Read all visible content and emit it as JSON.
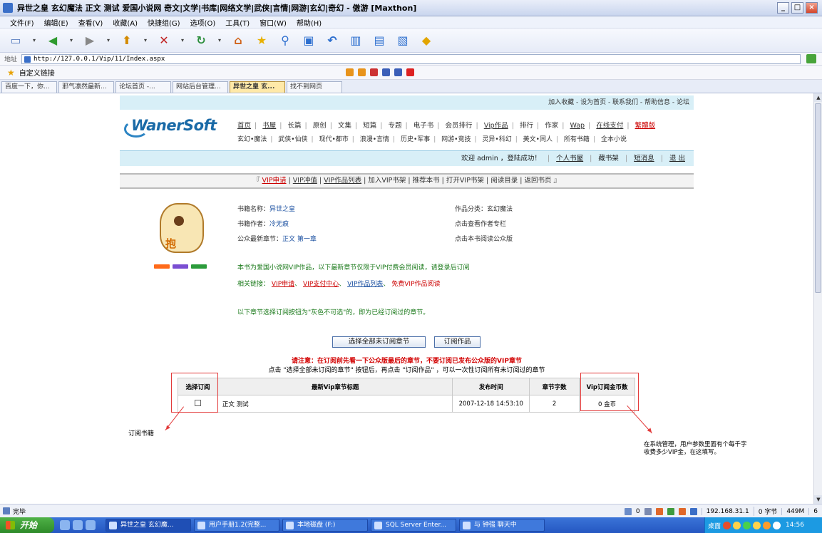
{
  "window": {
    "title": "异世之皇 玄幻魔法 正文 测试 爱国小说网 奇文|文学|书库|网络文学|武侠|言情|网游|玄幻|奇幻 - 傲游 [Maxthon]",
    "min_label": "_",
    "max_label": "□",
    "close_label": "×"
  },
  "menu": [
    "文件(F)",
    "编辑(E)",
    "查看(V)",
    "收藏(A)",
    "快捷组(G)",
    "选项(O)",
    "工具(T)",
    "窗口(W)",
    "帮助(H)"
  ],
  "address": {
    "label": "地址",
    "url": "http://127.0.0.1/Vip/11/Index.aspx"
  },
  "favbar": {
    "label": "自定义链接"
  },
  "tabs": [
    "百度一下，你...",
    "邪气凛然最新...",
    "论坛首页 -...",
    "网站后台管理...",
    "异世之皇 玄...",
    "找不到网页"
  ],
  "active_tab_index": 4,
  "site": {
    "topstrip": "加入收藏 - 设为首页 - 联系我们 - 帮助信息 - 论坛",
    "logo_text": "WanerSoft",
    "nav1": [
      "首页",
      "书屋",
      "长篇",
      "原创",
      "文集",
      "短篇",
      "专题",
      "电子书",
      "会员排行",
      "Vip作品",
      "排行",
      "作家",
      "Wap",
      "在线支付",
      "繁體版"
    ],
    "nav2": [
      "玄幻•魔法",
      "武侠•仙侠",
      "现代•都市",
      "浪漫•言情",
      "历史•军事",
      "网游•竞技",
      "灵异•科幻",
      "美文•同人",
      "所有书籍",
      "全本小说"
    ],
    "welcome": "欢迎 admin ，登陆成功！",
    "welcome_links": [
      "个人书屋",
      "藏书架",
      "短消息",
      "退 出"
    ],
    "vip_links": [
      "VIP申请",
      "VIP冲值",
      "VIP作品列表",
      "加入VIP书架",
      "推荐本书",
      "打开VIP书架",
      "阅读目录",
      "返回书页"
    ]
  },
  "book": {
    "name_label": "书籍名称：",
    "name": "异世之皇",
    "author_label": "书籍作者：",
    "author": "冷无痕",
    "latest_label": "公众最新章节：",
    "latest": "正文 第一章",
    "category_label": "作品分类：",
    "category": "玄幻魔法",
    "author_col": "点击查看作者专栏",
    "public_ver": "点击本书阅读公众版",
    "mascot_char": "抱"
  },
  "notices": {
    "n1": "本书为爱国小说网VIP作品，以下最新章节仅限于VIP付费会员阅读，请登录后订阅",
    "n2_label": "相关链接：",
    "n2_links": [
      "VIP申请",
      "VIP支付中心",
      "VIP作品列表",
      "免费VIP作品阅读"
    ],
    "n3": "以下章节选择订阅按钮为\"灰色不可选\"的，即为已经订阅过的章节。"
  },
  "buttons": {
    "select_all": "选择全部未订阅章节",
    "subscribe": "订阅作品"
  },
  "warning": "请注意：在订阅前先看一下公众版最后的章节，不要订阅已发布公众版的VIP章节",
  "tip": "点击 \"选择全部未订阅的章节\" 按钮后，再点击 \"订阅作品\" ，可以一次性订阅所有未订阅过的章节",
  "table": {
    "headers": [
      "选择订阅",
      "最新Vip章节标题",
      "发布时间",
      "章节字数",
      "Vip订阅金币数"
    ],
    "rows": [
      {
        "title": "正文 测试",
        "time": "2007-12-18 14:53:10",
        "words": "2",
        "coins": "0 金币"
      }
    ]
  },
  "annotations": {
    "a1": "订阅书籍",
    "a2": "在系统管理，用户参数里面有个每千字收费多少VIP金，在这填写。"
  },
  "status": {
    "left": "完毕",
    "num": "0",
    "ip": "192.168.31.1",
    "bytes": "0 字节",
    "size": "449M",
    "page": "6"
  },
  "taskbar": {
    "start": "开始",
    "tasks": [
      "异世之皇 玄幻魔...",
      "用户手册1.2(完整...",
      "本地磁盘 (F:)",
      "SQL Server Enter...",
      "与 钟强 聊天中"
    ],
    "active_task": 0,
    "desktop_label": "桌面",
    "clock": "14:56"
  }
}
